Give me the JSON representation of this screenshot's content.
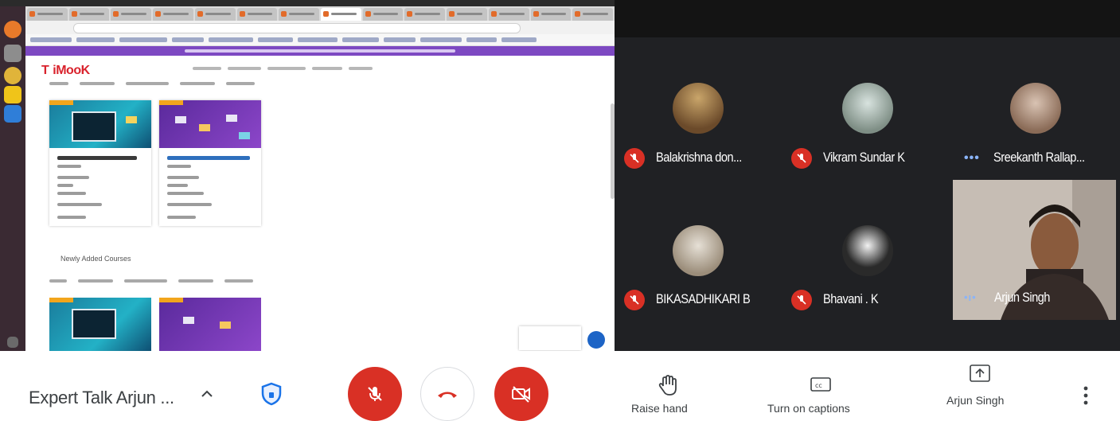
{
  "meeting": {
    "title": "Expert Talk Arjun ...",
    "present_label": "Arjun Singh",
    "raise_hand_label": "Raise hand",
    "captions_label": "Turn on captions"
  },
  "participants": [
    {
      "name": "Balakrishna don...",
      "status": "muted"
    },
    {
      "name": "Vikram Sundar K",
      "status": "muted"
    },
    {
      "name": "Sreekanth Rallap...",
      "status": "speaking"
    },
    {
      "name": "BIKASADHIKARI B",
      "status": "muted"
    },
    {
      "name": "Bhavani . K",
      "status": "muted"
    },
    {
      "name": "Arjun Singh",
      "status": "speaking"
    }
  ],
  "shared_screen": {
    "site_logo": "iMooK",
    "section_heading": "Newly Added Courses"
  },
  "colors": {
    "meet_background": "#202124",
    "mute_red": "#d93025",
    "banner_purple": "#7d49c2",
    "speaking_blue": "#8ab4f8"
  },
  "icons": [
    "shield-icon",
    "mic-off-icon",
    "hang-up-icon",
    "camera-off-icon",
    "raise-hand-icon",
    "captions-icon",
    "present-icon",
    "more-options-icon",
    "chevron-up-icon"
  ]
}
